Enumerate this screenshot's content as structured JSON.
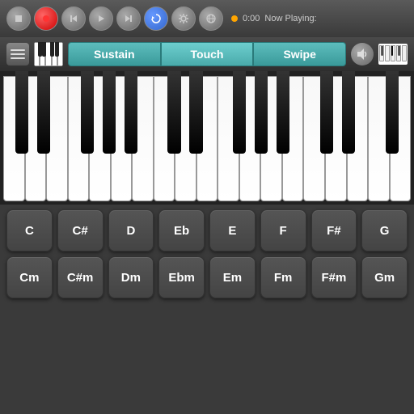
{
  "toolbar": {
    "time": "0:00",
    "now_playing_label": "Now Playing:",
    "buttons": [
      "stop",
      "record",
      "prev",
      "play",
      "next",
      "sync",
      "settings",
      "globe"
    ]
  },
  "mode_bar": {
    "sustain_label": "Sustain",
    "touch_label": "Touch",
    "swipe_label": "Swipe"
  },
  "chords_row1": [
    {
      "label": "C"
    },
    {
      "label": "C#"
    },
    {
      "label": "D"
    },
    {
      "label": "Eb"
    },
    {
      "label": "E"
    },
    {
      "label": "F"
    },
    {
      "label": "F#"
    },
    {
      "label": "G"
    }
  ],
  "chords_row2": [
    {
      "label": "Cm"
    },
    {
      "label": "C#m"
    },
    {
      "label": "Dm"
    },
    {
      "label": "Ebm"
    },
    {
      "label": "Em"
    },
    {
      "label": "Fm"
    },
    {
      "label": "F#m"
    },
    {
      "label": "Gm"
    }
  ]
}
